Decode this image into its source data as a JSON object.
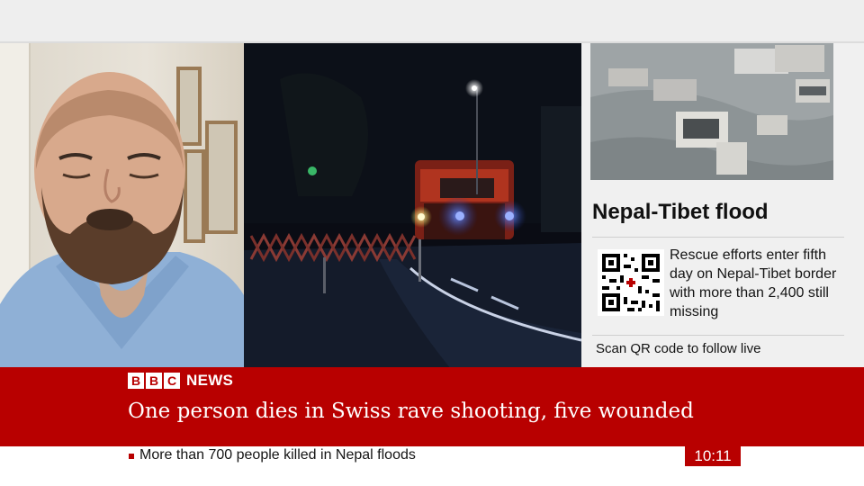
{
  "broadcast": {
    "brand": {
      "letters": [
        "B",
        "B",
        "C"
      ],
      "word": "NEWS",
      "brand_color": "#b80000"
    },
    "main_headline": "One person dies in Swiss rave shooting, five wounded",
    "ticker": {
      "text": "More than 700 people killed in Nepal floods",
      "clock": "10:11"
    }
  },
  "side_panel": {
    "headline": "Nepal-Tibet flood",
    "summary": "Rescue efforts enter fifth day on Nepal-Tibet border with more than 2,400 still missing",
    "cta": "Scan QR code to follow live",
    "qr_icon": "qr-code-icon"
  },
  "colors": {
    "banner": "#b80000",
    "panel_bg": "#f0f0f0",
    "text_dark": "#141414"
  }
}
